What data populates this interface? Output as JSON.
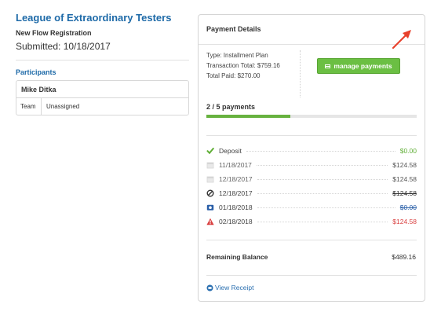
{
  "registration": {
    "org_title": "League of Extraordinary Testers",
    "subtitle": "New Flow Registration",
    "submitted": "Submitted: 10/18/2017"
  },
  "participants": {
    "heading": "Participants",
    "name": "Mike Ditka",
    "row_key": "Team",
    "row_value": "Unassigned"
  },
  "payment_details": {
    "title": "Payment Details",
    "type": "Type: Installment Plan",
    "transaction_total": "Transaction Total: $759.16",
    "total_paid": "Total Paid: $270.00",
    "manage_label": "manage payments",
    "progress_label": "2 / 5 payments",
    "progress_fraction": 0.4,
    "payments": [
      {
        "label": "Deposit",
        "amount": "$0.00",
        "icon": "check-icon",
        "status": "paid"
      },
      {
        "label": "11/18/2017",
        "amount": "$124.58",
        "icon": "calendar-icon",
        "status": "scheduled"
      },
      {
        "label": "12/18/2017",
        "amount": "$124.58",
        "icon": "calendar-icon",
        "status": "scheduled"
      },
      {
        "label": "12/18/2017",
        "amount": "$124.58",
        "icon": "cancelled-icon",
        "status": "cancelled"
      },
      {
        "label": "01/18/2018",
        "amount": "$0.00",
        "icon": "refund-icon",
        "status": "refunded"
      },
      {
        "label": "02/18/2018",
        "amount": "$124.58",
        "icon": "warning-icon",
        "status": "failed"
      }
    ],
    "remaining_label": "Remaining Balance",
    "remaining_amount": "$489.16",
    "view_receipt_label": "View Receipt"
  },
  "colors": {
    "link_blue": "#1e6aa8",
    "button_green": "#6bbf43",
    "progress_green": "#67b23f",
    "error_red": "#d94040",
    "arrow_red": "#e8412c"
  }
}
